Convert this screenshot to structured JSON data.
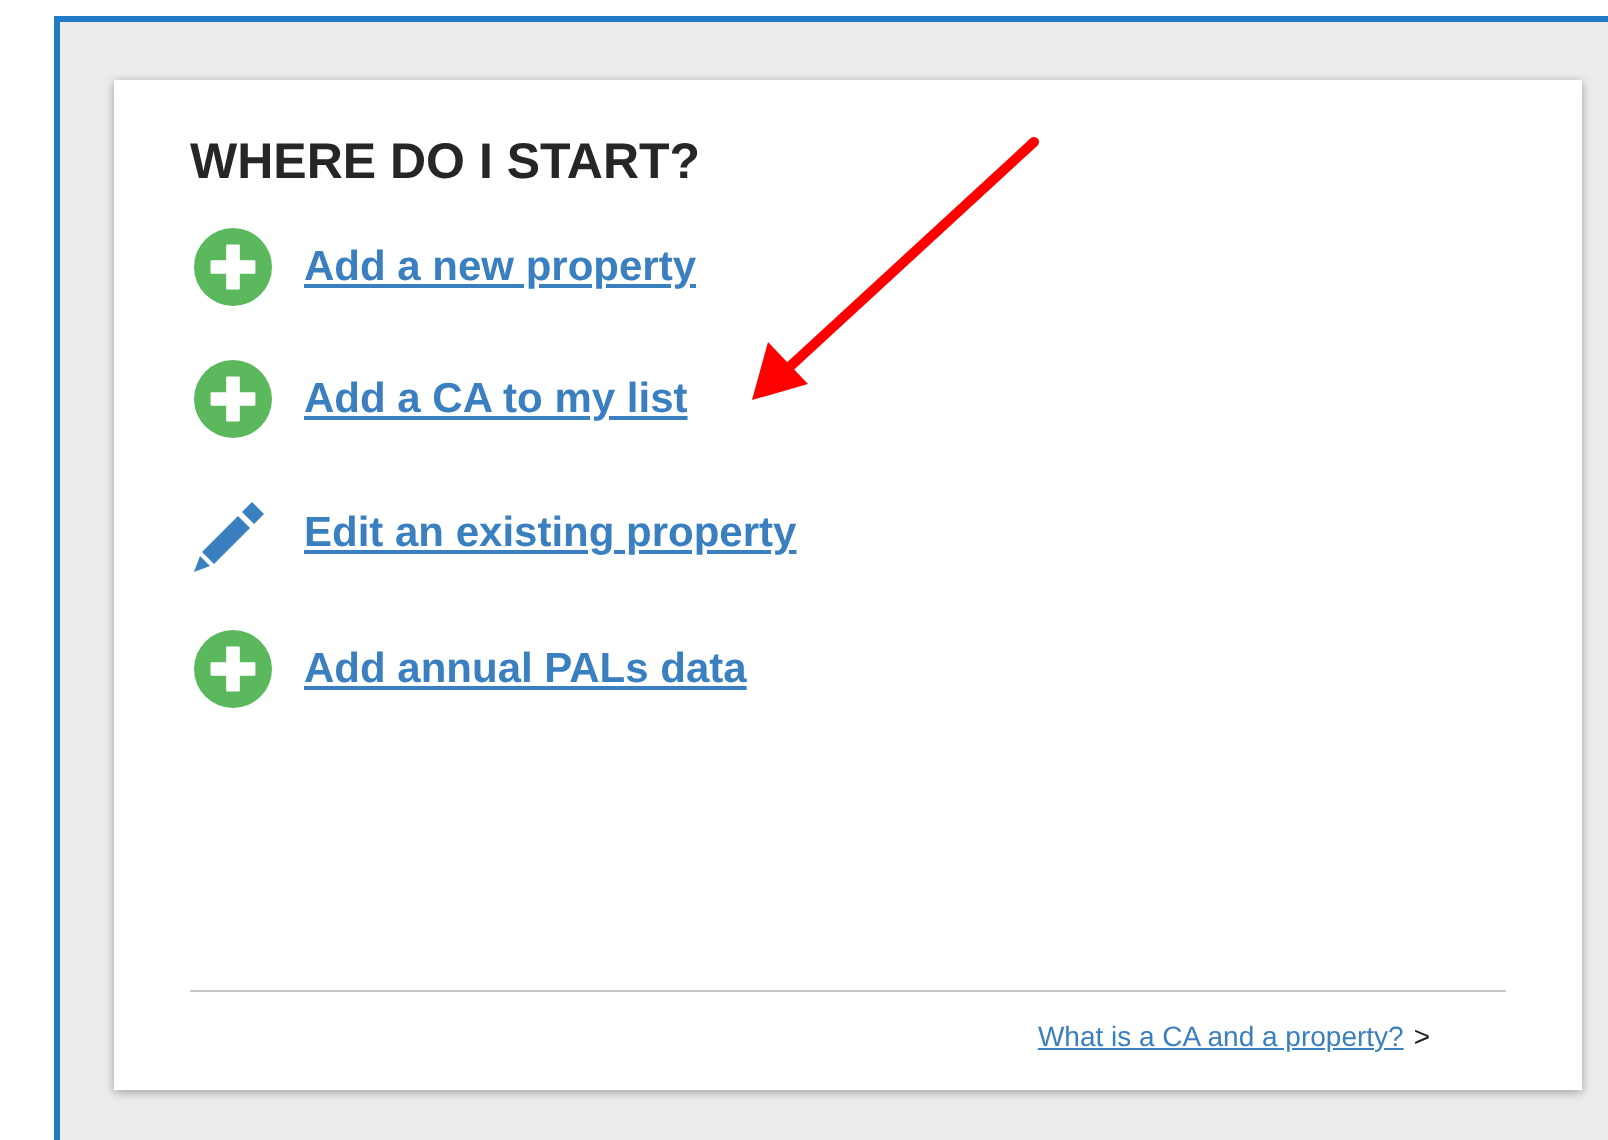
{
  "card": {
    "title": "WHERE DO I START?",
    "actions": [
      {
        "kind": "add",
        "label": "Add a new property"
      },
      {
        "kind": "add",
        "label": "Add a CA to my list"
      },
      {
        "kind": "edit",
        "label": "Edit an existing property"
      },
      {
        "kind": "add",
        "label": "Add annual PALs data"
      }
    ],
    "footer": {
      "link": "What is a CA and a property?",
      "chevron": ">"
    }
  }
}
